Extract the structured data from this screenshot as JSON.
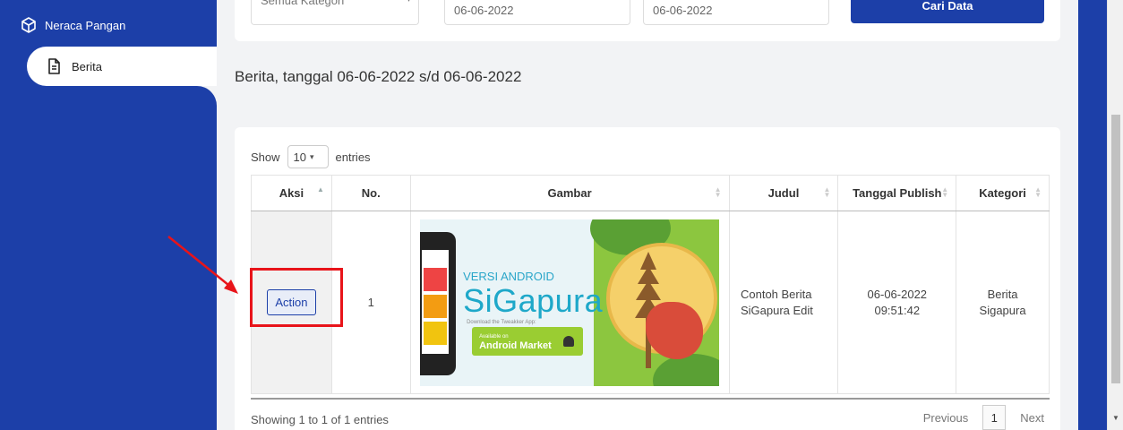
{
  "sidebar": {
    "items": [
      {
        "label": "Neraca Pangan",
        "icon": "cube-icon"
      },
      {
        "label": "Berita",
        "icon": "document-icon"
      }
    ]
  },
  "filter": {
    "category_value": "Semua Kategori",
    "date_from": "06-06-2022",
    "date_to": "06-06-2022",
    "search_button": "Cari Data"
  },
  "page_title": "Berita, tanggal 06-06-2022 s/d 06-06-2022",
  "table": {
    "show_label": "Show",
    "page_length": "10",
    "entries_label": "entries",
    "headers": [
      "Aksi",
      "No.",
      "Gambar",
      "Judul",
      "Tanggal Publish",
      "Kategori"
    ],
    "rows": [
      {
        "action": "Action",
        "no": "1",
        "image": {
          "version_text": "VERSI ANDROID",
          "brand_text": "SiGapura",
          "download_text": "Download the Tweakker App:",
          "market_small": "Available on",
          "market_text": "Android Market"
        },
        "title": "Contoh Berita SiGapura Edit",
        "publish_date": "06-06-2022",
        "publish_time": "09:51:42",
        "category": "Berita Sigapura"
      }
    ],
    "info": "Showing 1 to 1 of 1 entries",
    "pager": {
      "previous": "Previous",
      "current": "1",
      "next": "Next"
    }
  },
  "colors": {
    "primary": "#1c3fa8",
    "annotation": "#e8141a"
  }
}
